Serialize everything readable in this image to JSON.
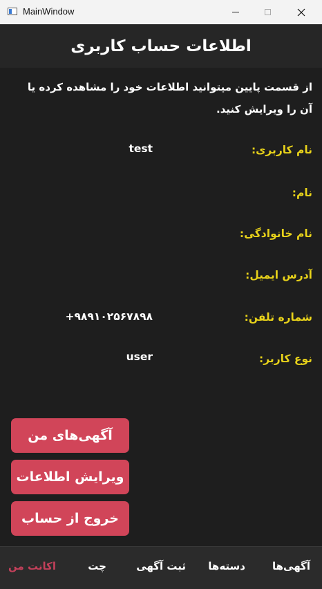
{
  "window": {
    "title": "MainWindow",
    "minimize_icon": "minimize-icon",
    "maximize_icon": "maximize-icon",
    "close_icon": "close-icon"
  },
  "header": {
    "title": "اطلاعات حساب کاربری"
  },
  "intro": "از قسمت پایین میتوانید اطلاعات خود را مشاهده کرده یا آن را ویرایش کنید.",
  "fields": [
    {
      "label": "نام کاربری:",
      "value": "test"
    },
    {
      "label": "نام:",
      "value": ""
    },
    {
      "label": "نام خانوادگی:",
      "value": ""
    },
    {
      "label": "آدرس ایمیل:",
      "value": ""
    },
    {
      "label": "شماره تلفن:",
      "value": "+۹۸۹۱۰۲۵۶۷۸۹۸"
    },
    {
      "label": "نوع کاربر:",
      "value": "user"
    }
  ],
  "actions": {
    "my_ads": "آگهی‌های من",
    "edit_info": "ویرایش اطلاعات",
    "logout": "خروج از حساب"
  },
  "nav": {
    "ads": "آگهی‌ها",
    "categories": "دسته‌ها",
    "post_ad": "ثبت آگهی",
    "chat": "چت",
    "my_account": "اکانت من",
    "active": "my_account"
  },
  "colors": {
    "background": "#1e1e1e",
    "header": "#262626",
    "label": "#e8d21a",
    "button": "#d14559",
    "nav_active": "#c2405a",
    "nav_bar": "#2b2b2b"
  }
}
